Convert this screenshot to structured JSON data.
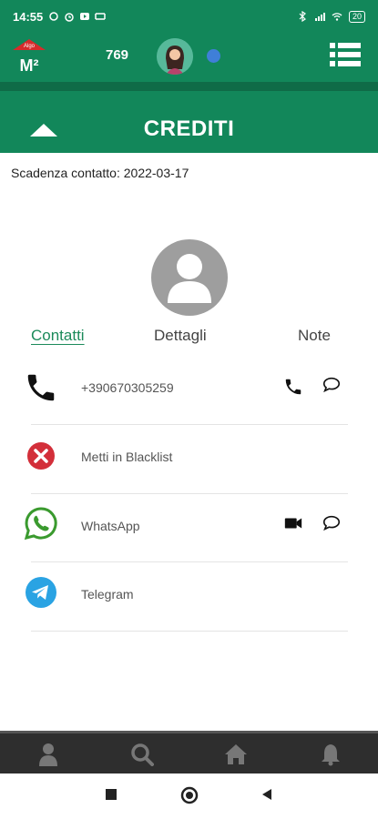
{
  "status_bar": {
    "time": "14:55",
    "battery": "20"
  },
  "header": {
    "logo_text": "M²",
    "logo_brand": "Algo",
    "counter": "769"
  },
  "section": {
    "title": "CREDITI"
  },
  "contact": {
    "expiry_label": "Scadenza contatto: 2022-03-17"
  },
  "tabs": [
    {
      "label": "Contatti",
      "active": true
    },
    {
      "label": "Dettagli",
      "active": false
    },
    {
      "label": "Note",
      "active": false
    }
  ],
  "rows": [
    {
      "label": "+390670305259",
      "icon": "phone-icon",
      "actions": [
        "phone-icon",
        "chat-bubble-icon"
      ]
    },
    {
      "label": "Metti in Blacklist",
      "icon": "blacklist-x-icon",
      "actions": []
    },
    {
      "label": "WhatsApp",
      "icon": "whatsapp-icon",
      "actions": [
        "video-camera-icon",
        "chat-bubble-icon"
      ]
    },
    {
      "label": "Telegram",
      "icon": "telegram-icon",
      "actions": []
    }
  ],
  "bottom_nav": [
    "profile-icon",
    "search-icon",
    "home-icon",
    "bell-icon"
  ],
  "colors": {
    "primary": "#12875a",
    "dark_green": "#0f6b47",
    "online": "#3f7fd8",
    "tab_active": "#1b8a5a"
  }
}
